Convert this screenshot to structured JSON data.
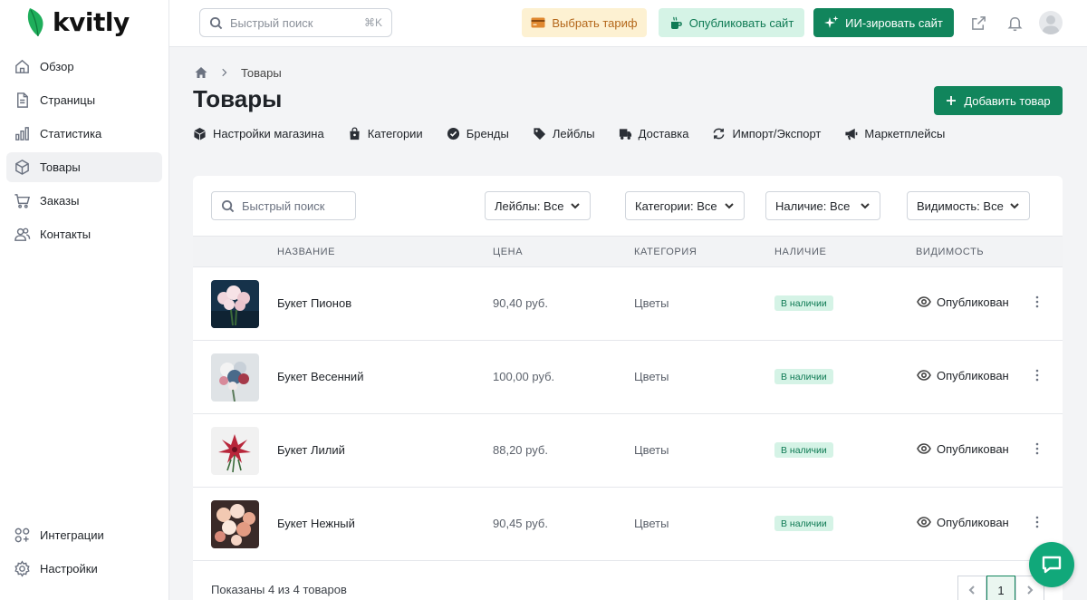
{
  "brand": {
    "name": "kvitly",
    "accent": "#11855c"
  },
  "sidebar": {
    "items": [
      {
        "label": "Обзор",
        "icon": "home-icon"
      },
      {
        "label": "Страницы",
        "icon": "document-icon"
      },
      {
        "label": "Статистика",
        "icon": "bar-chart-icon"
      },
      {
        "label": "Товары",
        "icon": "box-icon",
        "active": true
      },
      {
        "label": "Заказы",
        "icon": "cart-icon"
      },
      {
        "label": "Контакты",
        "icon": "users-icon"
      }
    ],
    "bottom": [
      {
        "label": "Интеграции",
        "icon": "integrations-icon"
      },
      {
        "label": "Настройки",
        "icon": "gear-icon"
      }
    ]
  },
  "topbar": {
    "search_placeholder": "Быстрый поиск",
    "search_shortcut": "⌘K",
    "tariff_label": "Выбрать тариф",
    "publish_label": "Опубликовать сайт",
    "ai_label": "ИИ-зировать сайт"
  },
  "breadcrumb": {
    "current": "Товары"
  },
  "page": {
    "title": "Товары",
    "add_label": "Добавить товар"
  },
  "subnav": [
    {
      "label": "Настройки магазина",
      "icon": "cube-icon"
    },
    {
      "label": "Категории",
      "icon": "bag-icon"
    },
    {
      "label": "Бренды",
      "icon": "verified-icon"
    },
    {
      "label": "Лейблы",
      "icon": "tag-icon"
    },
    {
      "label": "Доставка",
      "icon": "truck-icon"
    },
    {
      "label": "Импорт/Экспорт",
      "icon": "sync-icon"
    },
    {
      "label": "Маркетплейсы",
      "icon": "megaphone-icon"
    }
  ],
  "filters": {
    "search_placeholder": "Быстрый поиск",
    "labels": "Лейблы: Все",
    "categories": "Категории: Все",
    "stock": "Наличие: Все",
    "visibility": "Видимость: Все"
  },
  "table": {
    "headers": {
      "name": "НАЗВАНИЕ",
      "price": "ЦЕНА",
      "category": "КАТЕГОРИЯ",
      "stock": "НАЛИЧИЕ",
      "visibility": "ВИДИМОСТЬ"
    },
    "rows": [
      {
        "name": "Букет Пионов",
        "price": "90,40 руб.",
        "category": "Цветы",
        "stock": "В наличии",
        "visibility": "Опубликован"
      },
      {
        "name": "Букет Весенний",
        "price": "100,00 руб.",
        "category": "Цветы",
        "stock": "В наличии",
        "visibility": "Опубликован"
      },
      {
        "name": "Букет Лилий",
        "price": "88,20 руб.",
        "category": "Цветы",
        "stock": "В наличии",
        "visibility": "Опубликован"
      },
      {
        "name": "Букет Нежный",
        "price": "90,45 руб.",
        "category": "Цветы",
        "stock": "В наличии",
        "visibility": "Опубликован"
      }
    ]
  },
  "footer": {
    "summary": "Показаны 4 из 4 товаров",
    "current_page": "1"
  }
}
